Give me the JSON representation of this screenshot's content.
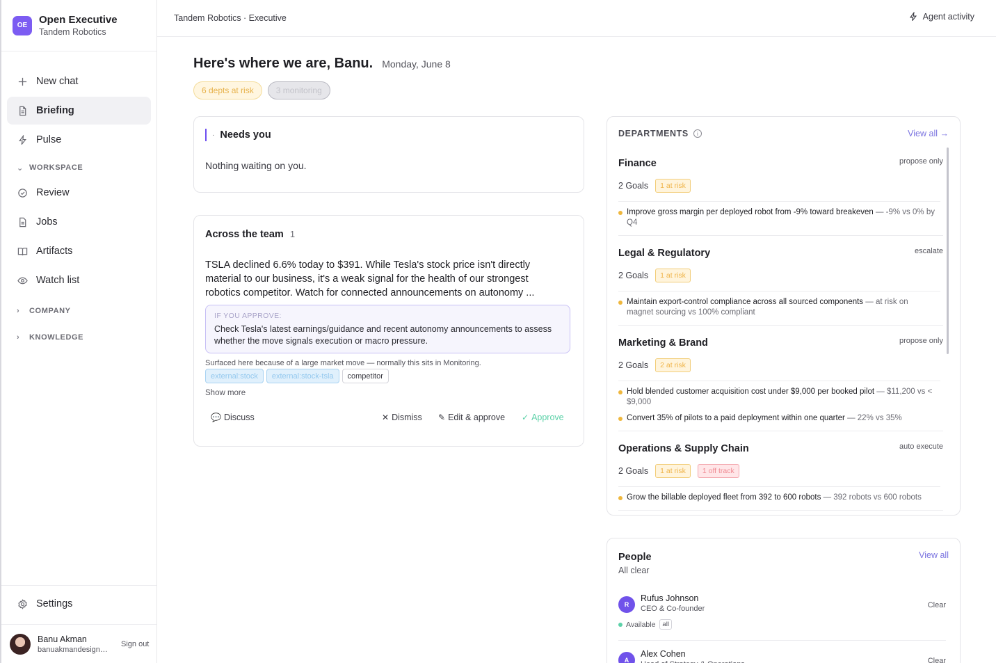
{
  "brand": {
    "logo": "OE",
    "title": "Open Executive",
    "subtitle": "Tandem Robotics"
  },
  "nav": {
    "new_chat": "New chat",
    "briefing": "Briefing",
    "pulse": "Pulse",
    "workspace": "WORKSPACE",
    "review": "Review",
    "jobs": "Jobs",
    "artifacts": "Artifacts",
    "watch_list": "Watch list",
    "company": "COMPANY",
    "knowledge": "KNOWLEDGE",
    "settings": "Settings"
  },
  "user": {
    "name": "Banu Akman",
    "email": "banuakmandesign@g...",
    "signout": "Sign out"
  },
  "topbar": {
    "breadcrumb": "Tandem Robotics · Executive",
    "agent_activity": "Agent activity"
  },
  "header": {
    "title": "Here's where we are, Banu.",
    "date": "Monday, June 8",
    "pill_risk": "6 depts at risk",
    "pill_monitoring": "3 monitoring"
  },
  "needs": {
    "title": "Needs you",
    "body": "Nothing waiting on you."
  },
  "team": {
    "title": "Across the team",
    "count": "1",
    "text": "TSLA declined 6.6% today to $391. While Tesla's stock price isn't directly material to our business, it's a weak signal for the health of our strongest robotics competitor. Watch for connected announcements on autonomy ...",
    "approve_label": "IF YOU APPROVE:",
    "approve_text": "Check Tesla's latest earnings/guidance and recent autonomy announcements to assess whether the move signals execution or macro pressure.",
    "surfaced": "Surfaced here because of a large market move — normally this sits in Monitoring.",
    "tags": [
      "external:stock",
      "external:stock-tsla",
      "competitor"
    ],
    "show_more": "Show more",
    "discuss": "Discuss",
    "dismiss": "Dismiss",
    "edit_approve": "Edit & approve",
    "approve": "Approve"
  },
  "departments": {
    "title": "DEPARTMENTS",
    "view_all": "View all →",
    "items": [
      {
        "name": "Finance",
        "mode": "propose only",
        "goals": "2 Goals",
        "badges": [
          {
            "text": "1 at risk",
            "kind": "risk"
          }
        ],
        "goal_items": [
          {
            "main": "Improve gross margin per deployed robot from -9% toward breakeven",
            "sub": " — -9% vs 0% by Q4"
          }
        ]
      },
      {
        "name": "Legal & Regulatory",
        "mode": "escalate",
        "goals": "2 Goals",
        "badges": [
          {
            "text": "1 at risk",
            "kind": "risk"
          }
        ],
        "goal_items": [
          {
            "main": "Maintain export-control compliance across all sourced components",
            "sub": " — at risk on magnet sourcing vs 100% compliant"
          }
        ]
      },
      {
        "name": "Marketing & Brand",
        "mode": "propose only",
        "goals": "2 Goals",
        "badges": [
          {
            "text": "2 at risk",
            "kind": "risk"
          }
        ],
        "goal_items": [
          {
            "main": "Hold blended customer acquisition cost under $9,000 per booked pilot",
            "sub": " — $11,200 vs < $9,000"
          },
          {
            "main": "Convert 35% of pilots to a paid deployment within one quarter",
            "sub": " — 22% vs 35%"
          }
        ]
      },
      {
        "name": "Operations & Supply Chain",
        "mode": "auto execute",
        "goals": "2 Goals",
        "badges": [
          {
            "text": "1 at risk",
            "kind": "risk"
          },
          {
            "text": "1 off track",
            "kind": "off"
          }
        ],
        "goal_items": [
          {
            "main": "Grow the billable deployed fleet from 392 to 600 robots",
            "sub": " — 392 robots vs 600 robots"
          }
        ]
      }
    ]
  },
  "people": {
    "title": "People",
    "subtitle": "All clear",
    "view_all": "View all",
    "items": [
      {
        "initial": "R",
        "name": "Rufus Johnson",
        "role": "CEO & Co-founder",
        "status": "Clear",
        "availability": "Available",
        "scope": "all"
      },
      {
        "initial": "A",
        "name": "Alex Cohen",
        "role": "Head of Strategy & Operations",
        "status": "Clear"
      }
    ]
  },
  "colors": {
    "accent": "#7c5cf2",
    "risk": "#efb73d",
    "off_track": "#f08a93",
    "approve": "#5cd1a8",
    "link": "#7b74e0"
  }
}
